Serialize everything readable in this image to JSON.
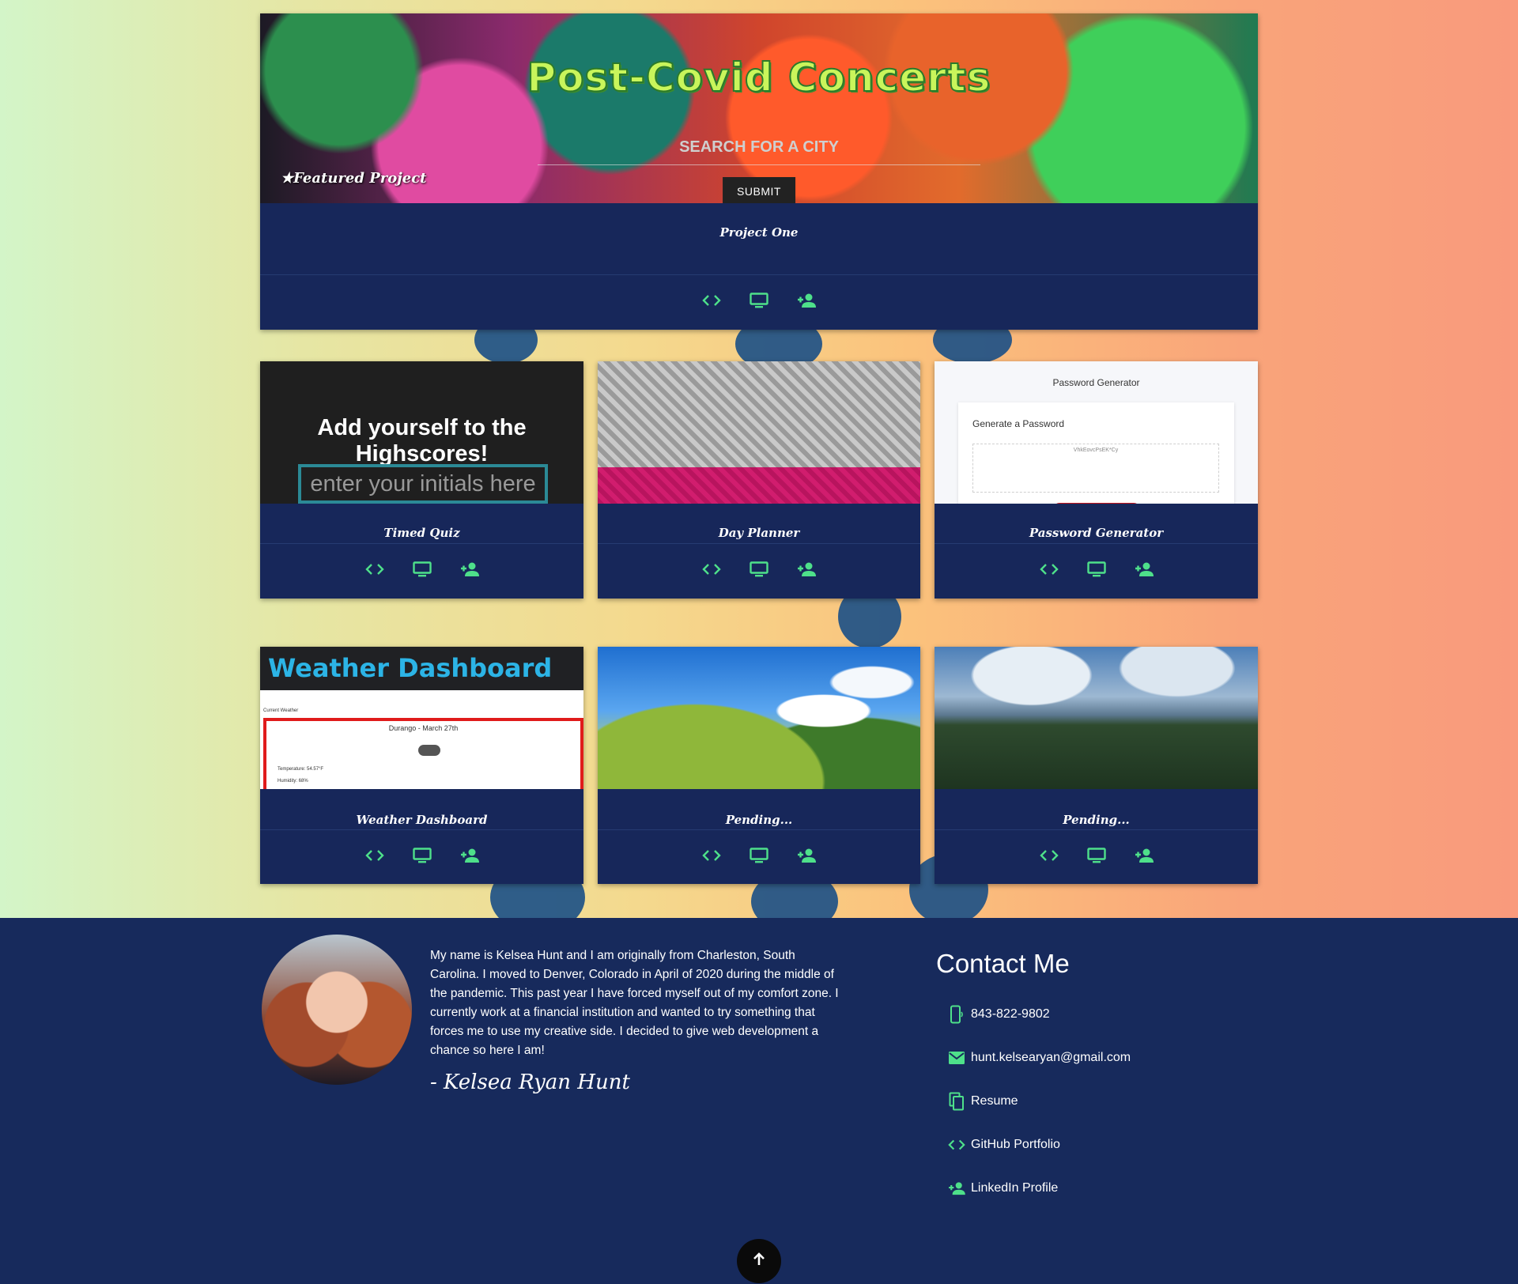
{
  "colors": {
    "card_bg": "#17275a",
    "icon_accent": "#4ee08a",
    "footer_bg": "#172a5c"
  },
  "featured": {
    "banner_title": "Post-Covid Concerts",
    "search_placeholder": "SEARCH FOR A CITY",
    "submit_label": "SUBMIT",
    "featured_label": "★Featured Project",
    "title": "Project One",
    "actions": [
      "code-icon",
      "monitor-icon",
      "person-add-icon"
    ]
  },
  "projects": [
    {
      "title": "Timed Quiz",
      "preview_heading": "Add yourself to the Highscores!",
      "preview_input_placeholder": "enter your initials here"
    },
    {
      "title": "Day Planner"
    },
    {
      "title": "Password Generator",
      "preview_heading": "Password Generator",
      "preview_subheading": "Generate a Password",
      "preview_value": "VhkEovcPsEK*Cy"
    },
    {
      "title": "Weather Dashboard",
      "preview_heading": "Weather Dashboard",
      "preview_label": "Current Weather",
      "preview_city": "Durango - March 27th",
      "preview_temp": "Temperature: 54.57°F",
      "preview_humidity": "Humidity: 68%"
    },
    {
      "title": "Pending..."
    },
    {
      "title": "Pending..."
    }
  ],
  "about": {
    "bio": "My name is Kelsea Hunt and I am originally from Charleston, South Carolina. I moved to Denver, Colorado in April of 2020 during the middle of the pandemic. This past year I have forced myself out of my comfort zone. I currently work at a financial institution and wanted to try something that forces me to use my creative side. I decided to give web development a chance so here I am!",
    "signature": "- Kelsea Ryan Hunt"
  },
  "contact": {
    "title": "Contact Me",
    "items": [
      {
        "icon": "phone-icon",
        "label": "843-822-9802"
      },
      {
        "icon": "email-icon",
        "label": "hunt.kelsearyan@gmail.com"
      },
      {
        "icon": "copy-icon",
        "label": "Resume"
      },
      {
        "icon": "code-icon",
        "label": "GitHub Portfolio"
      },
      {
        "icon": "person-add-icon",
        "label": "LinkedIn Profile"
      }
    ]
  }
}
